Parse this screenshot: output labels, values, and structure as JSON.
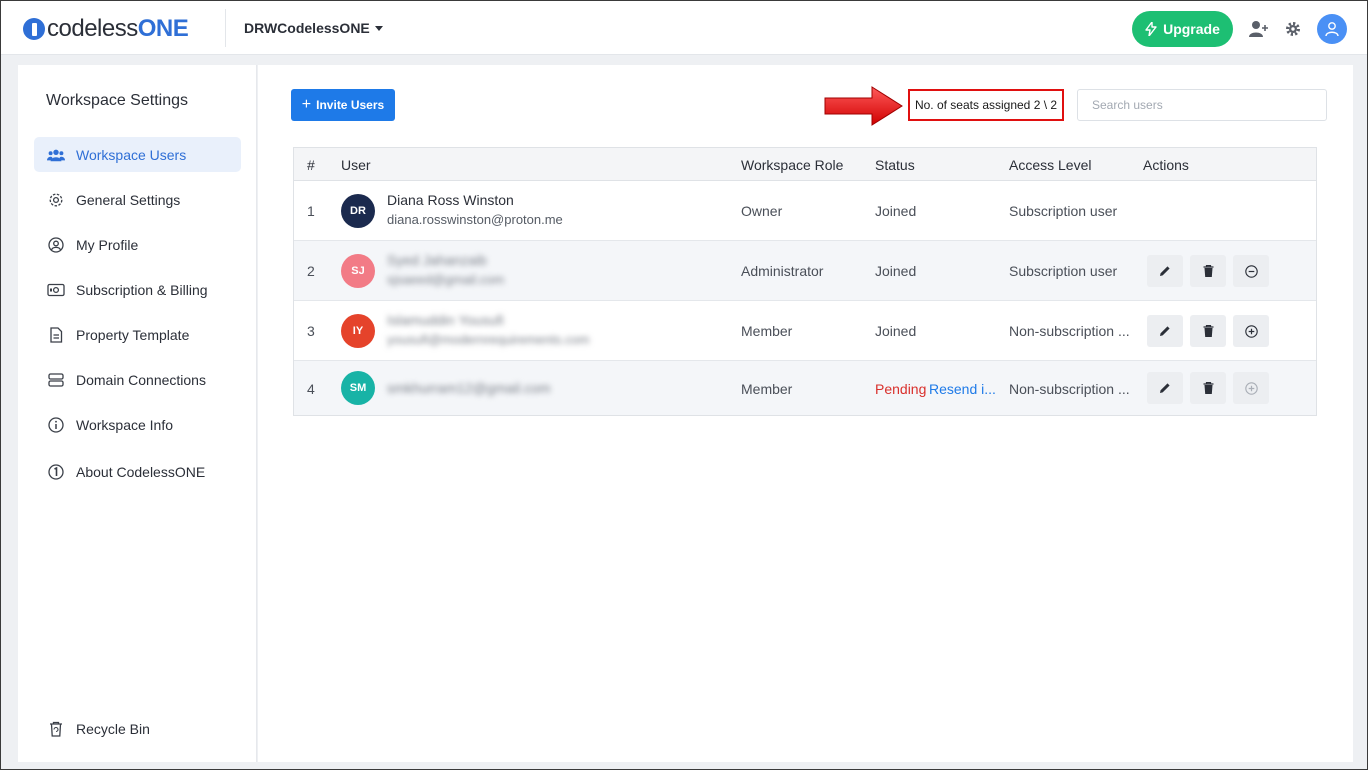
{
  "header": {
    "logo_prefix": "codeless",
    "logo_suffix": "ONE",
    "workspace_name": "DRWCodelessONE",
    "upgrade_label": "Upgrade"
  },
  "sidebar": {
    "title": "Workspace Settings",
    "items": [
      {
        "label": "Workspace Users",
        "icon": "users-icon",
        "active": true
      },
      {
        "label": "General Settings",
        "icon": "gear-icon"
      },
      {
        "label": "My Profile",
        "icon": "user-circle-icon"
      },
      {
        "label": "Subscription & Billing",
        "icon": "billing-icon"
      },
      {
        "label": "Property Template",
        "icon": "document-icon"
      },
      {
        "label": "Domain Connections",
        "icon": "server-icon"
      },
      {
        "label": "Workspace Info",
        "icon": "info-icon"
      },
      {
        "label": "About CodelessONE",
        "icon": "codelessone-icon"
      }
    ],
    "recycle_bin": {
      "label": "Recycle Bin",
      "icon": "recycle-bin-icon"
    }
  },
  "toolbar": {
    "invite_label": "Invite Users",
    "seats_text": "No. of seats assigned 2 \\ 2",
    "search_placeholder": "Search users"
  },
  "table": {
    "columns": [
      "#",
      "User",
      "Workspace Role",
      "Status",
      "Access Level",
      "Actions"
    ],
    "rows": [
      {
        "num": "1",
        "initials": "DR",
        "avatar_color": "#1b2a4e",
        "name": "Diana Ross Winston",
        "email": "diana.rosswinston@proton.me",
        "role": "Owner",
        "status": "Joined",
        "resend": "",
        "access": "Subscription user",
        "actions": []
      },
      {
        "num": "2",
        "initials": "SJ",
        "avatar_color": "#f27b86",
        "name": "Syed Jahanzaib",
        "email": "sjsaeed@gmail.com",
        "role": "Administrator",
        "status": "Joined",
        "resend": "",
        "access": "Subscription user",
        "actions": [
          "edit",
          "delete",
          "remove-seat"
        ]
      },
      {
        "num": "3",
        "initials": "IY",
        "avatar_color": "#e5432b",
        "name": "Islamuddin Yousufi",
        "email": "yousufi@modernrequirements.com",
        "role": "Member",
        "status": "Joined",
        "resend": "",
        "access": "Non-subscription ...",
        "actions": [
          "edit",
          "delete",
          "add-seat"
        ]
      },
      {
        "num": "4",
        "initials": "SM",
        "avatar_color": "#18b3a6",
        "name": "",
        "email": "smkhurram12@gmail.com",
        "role": "Member",
        "status": "Pending",
        "resend": "Resend i...",
        "access": "Non-subscription ...",
        "actions": [
          "edit",
          "delete",
          "add-seat-disabled"
        ]
      }
    ]
  },
  "colors": {
    "brand": "#2f6fd6",
    "upgrade": "#1dbf73",
    "invite": "#1e7ae8",
    "highlight": "#e01010",
    "pending": "#d9302c"
  }
}
